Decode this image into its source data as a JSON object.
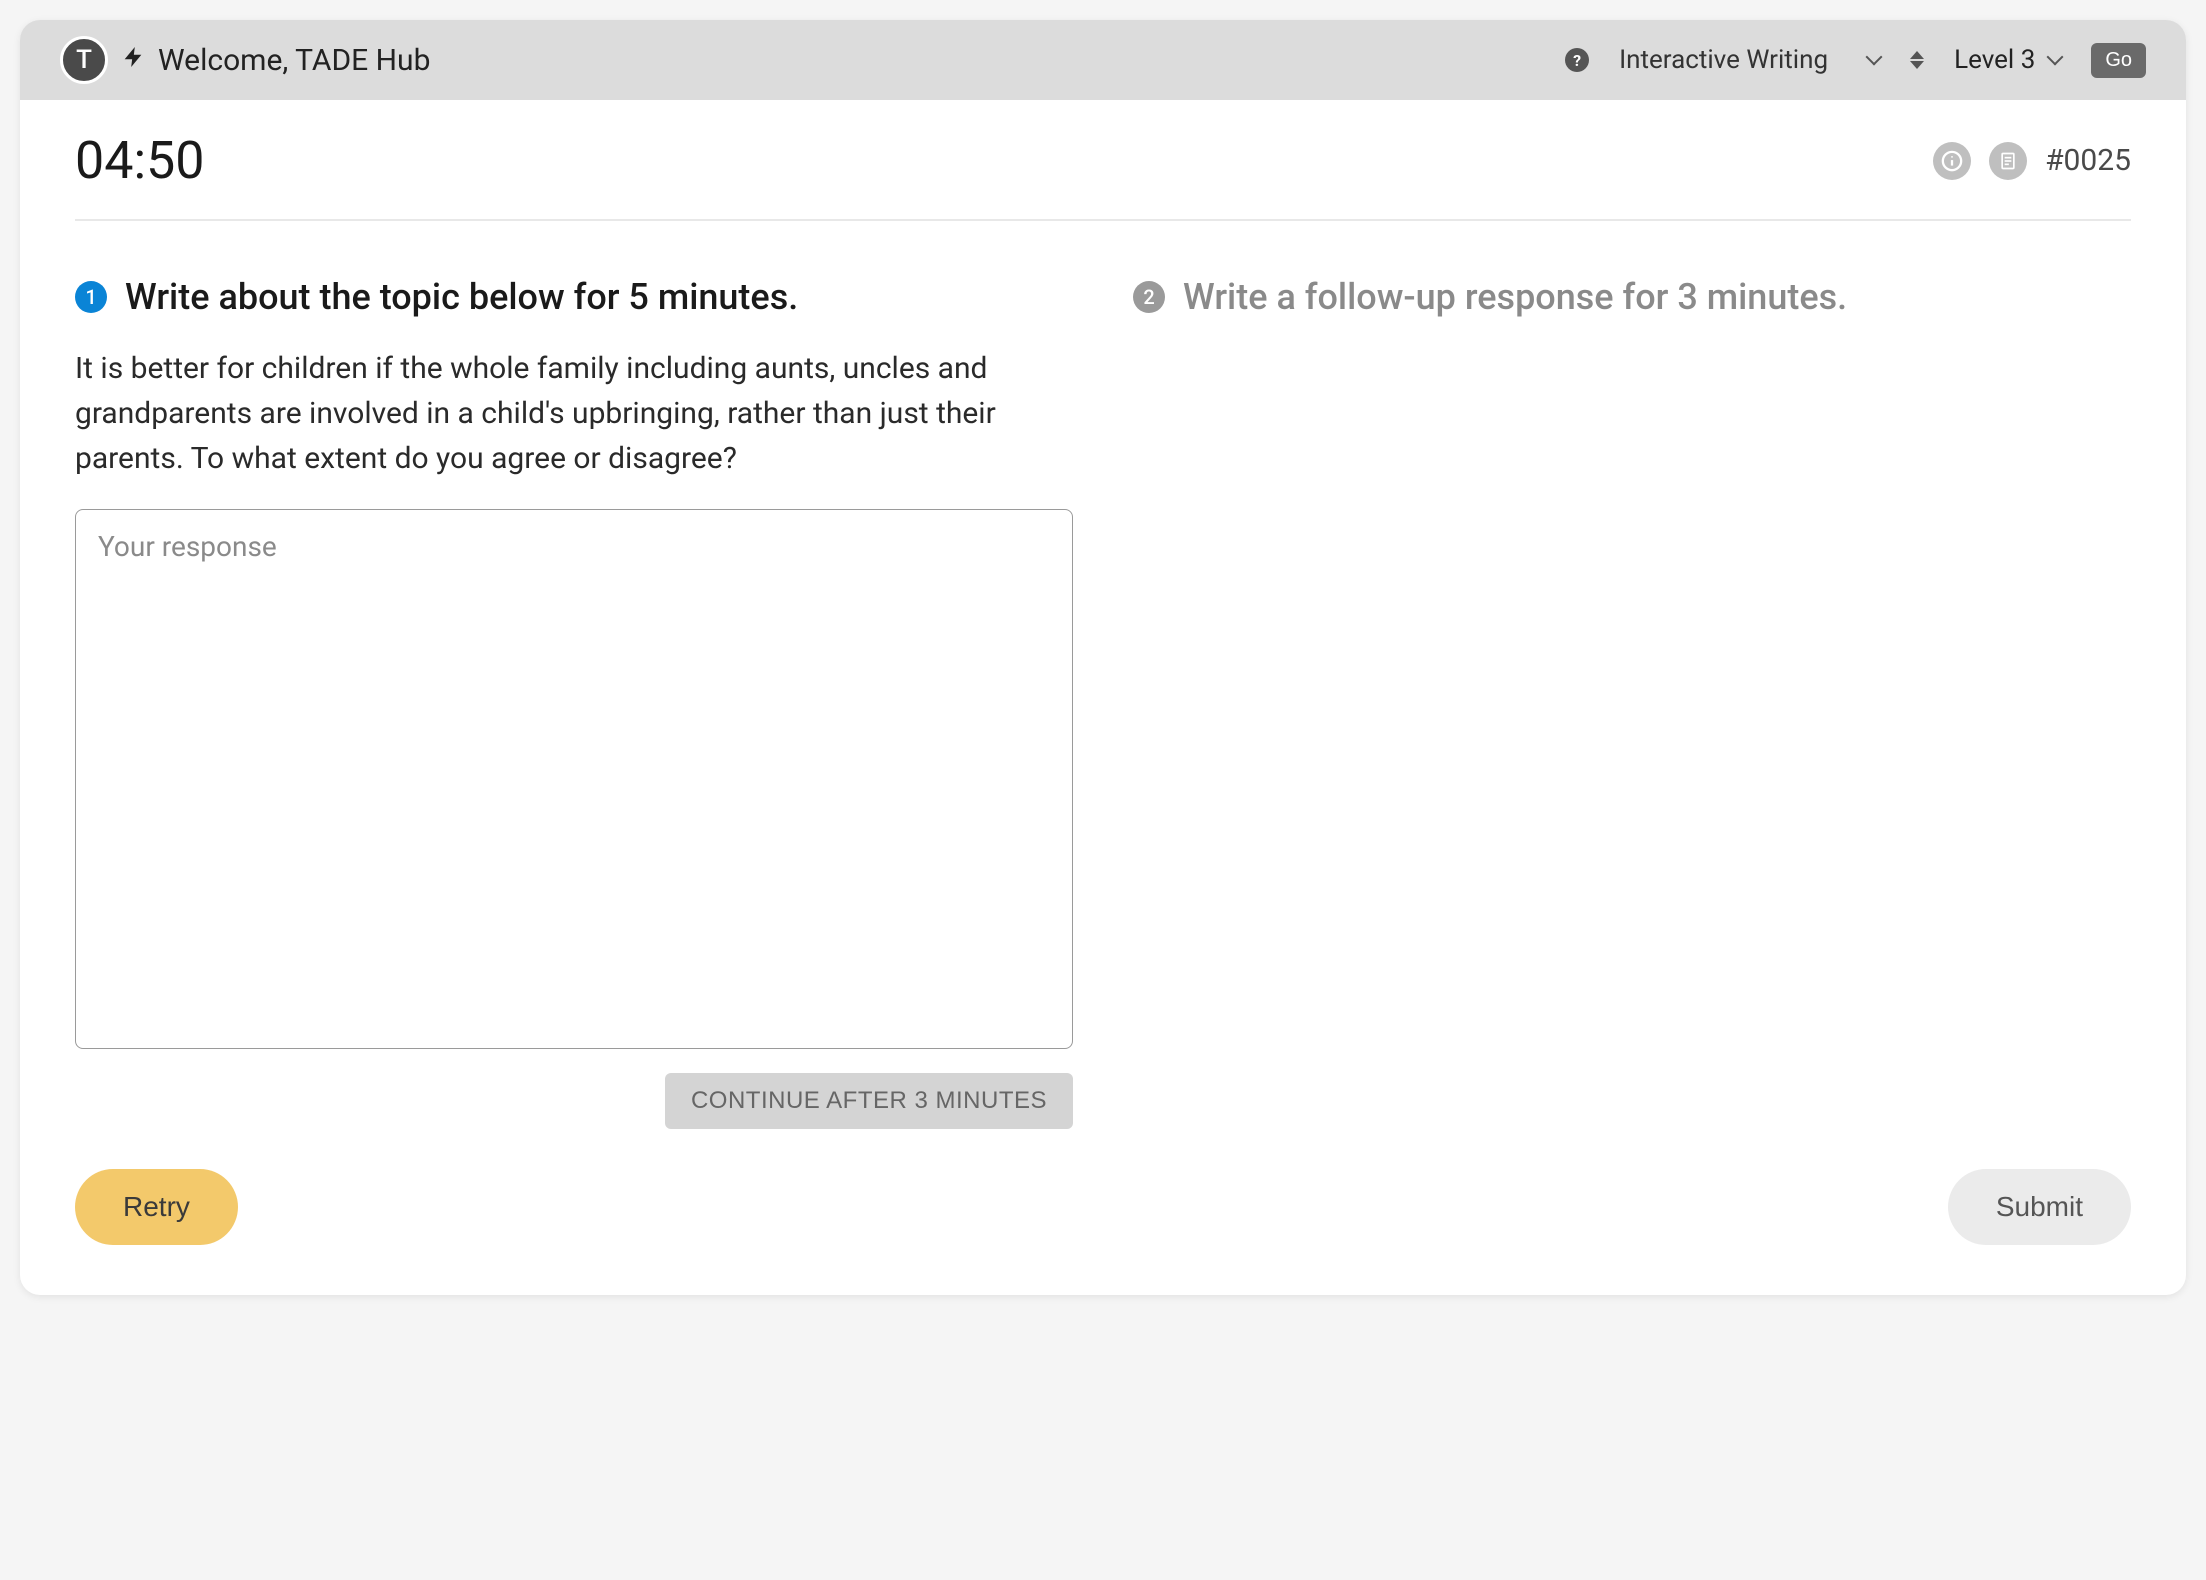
{
  "header": {
    "avatar_letter": "T",
    "welcome_text": "Welcome, TADE Hub",
    "mode_label": "Interactive Writing",
    "level_label": "Level 3",
    "go_label": "Go"
  },
  "info": {
    "timer": "04:50",
    "question_id": "#0025"
  },
  "steps": {
    "step1": {
      "number": "1",
      "title": "Write about the topic below for 5 minutes.",
      "prompt": "It is better for children if the whole family including aunts, uncles and grandparents are involved in a child's upbringing, rather than just their parents. To what extent do you agree or disagree?",
      "placeholder": "Your response",
      "continue_label": "CONTINUE AFTER 3 MINUTES"
    },
    "step2": {
      "number": "2",
      "title": "Write a follow-up response for 3 minutes."
    }
  },
  "footer": {
    "retry_label": "Retry",
    "submit_label": "Submit"
  }
}
